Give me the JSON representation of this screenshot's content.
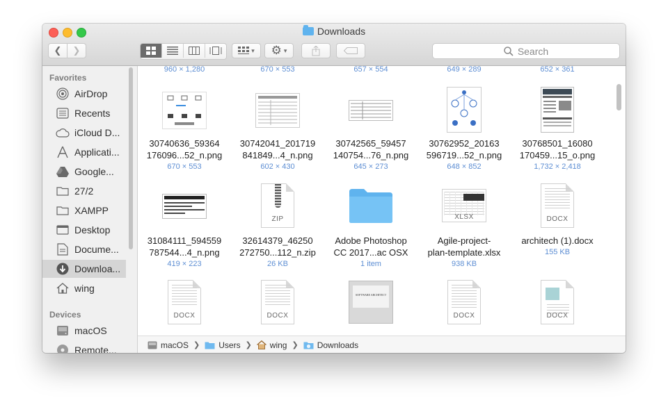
{
  "window": {
    "title": "Downloads"
  },
  "toolbar": {
    "search_placeholder": "Search"
  },
  "sidebar": {
    "favorites_header": "Favorites",
    "devices_header": "Devices",
    "favorites": [
      {
        "label": "AirDrop",
        "icon": "airdrop-icon"
      },
      {
        "label": "Recents",
        "icon": "recents-icon"
      },
      {
        "label": "iCloud D...",
        "icon": "cloud-icon"
      },
      {
        "label": "Applicati...",
        "icon": "applications-icon"
      },
      {
        "label": "Google...",
        "icon": "google-drive-icon"
      },
      {
        "label": "27/2",
        "icon": "folder-icon"
      },
      {
        "label": "XAMPP",
        "icon": "folder-icon"
      },
      {
        "label": "Desktop",
        "icon": "desktop-icon"
      },
      {
        "label": "Docume...",
        "icon": "documents-icon"
      },
      {
        "label": "Downloa...",
        "icon": "downloads-icon",
        "selected": true
      },
      {
        "label": "wing",
        "icon": "home-icon"
      }
    ],
    "devices": [
      {
        "label": "macOS",
        "icon": "hard-drive-icon"
      },
      {
        "label": "Remote...",
        "icon": "remote-disc-icon"
      }
    ]
  },
  "files": {
    "top_row_meta": [
      "960 × 1,280",
      "670 × 553",
      "657 × 554",
      "649 × 289",
      "652 × 361"
    ],
    "rows": [
      [
        {
          "name1": "30740636_59364",
          "name2": "176096...52_n.png",
          "meta": "670 × 553",
          "kind": "image"
        },
        {
          "name1": "30742041_201719",
          "name2": "841849...4_n.png",
          "meta": "602 × 430",
          "kind": "image"
        },
        {
          "name1": "30742565_59457",
          "name2": "140754...76_n.png",
          "meta": "645 × 273",
          "kind": "image"
        },
        {
          "name1": "30762952_20163",
          "name2": "596719...52_n.png",
          "meta": "648 × 852",
          "kind": "image"
        },
        {
          "name1": "30768501_16080",
          "name2": "170459...15_o.png",
          "meta": "1,732 × 2,418",
          "kind": "image"
        }
      ],
      [
        {
          "name1": "31084111_594559",
          "name2": "787544...4_n.png",
          "meta": "419 × 223",
          "kind": "image"
        },
        {
          "name1": "32614379_46250",
          "name2": "272750...112_n.zip",
          "meta": "26 KB",
          "kind": "zip",
          "badge": "ZIP"
        },
        {
          "name1": "Adobe Photoshop",
          "name2": "CC 2017...ac OSX",
          "meta": "1 item",
          "kind": "folder"
        },
        {
          "name1": "Agile-project-",
          "name2": "plan-template.xlsx",
          "meta": "938 KB",
          "kind": "xlsx",
          "badge": "XLSX"
        },
        {
          "name1": "architech (1).docx",
          "name2": "",
          "meta": "155 KB",
          "kind": "docx",
          "badge": "DOCX"
        }
      ],
      [
        {
          "kind": "docx",
          "badge": "DOCX"
        },
        {
          "kind": "docx",
          "badge": "DOCX"
        },
        {
          "kind": "screen",
          "screen_text": "SOFTWARE ARCHITECT"
        },
        {
          "kind": "docx",
          "badge": "DOCX"
        },
        {
          "kind": "docx",
          "badge": "DOCX"
        }
      ]
    ]
  },
  "pathbar": [
    {
      "label": "macOS",
      "icon": "hard-drive-icon"
    },
    {
      "label": "Users",
      "icon": "folder-icon"
    },
    {
      "label": "wing",
      "icon": "home-icon"
    },
    {
      "label": "Downloads",
      "icon": "downloads-folder-icon"
    }
  ],
  "colors": {
    "accent": "#5d8ed3",
    "folder": "#5fb3ee",
    "sidebar_bg": "#f0f0f0"
  }
}
